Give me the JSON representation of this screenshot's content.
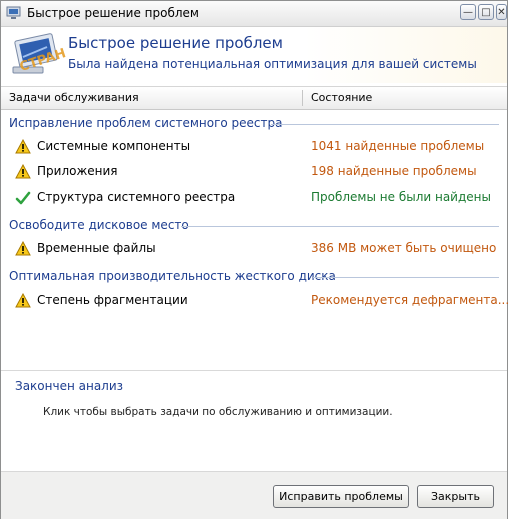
{
  "window": {
    "title": "Быстрое решение проблем"
  },
  "header": {
    "title": "Быстрое решение проблем",
    "subtitle": "Была найдена потенциальная оптимизация для вашей системы"
  },
  "columns": {
    "tasks": "Задачи обслуживания",
    "status": "Состояние"
  },
  "groups": [
    {
      "title": "Исправление проблем системного реестра",
      "items": [
        {
          "name": "Системные компоненты",
          "status": "1041 найденные проблемы",
          "icon": "warning-icon",
          "state": "warning"
        },
        {
          "name": "Приложения",
          "status": "198 найденные проблемы",
          "icon": "warning-icon",
          "state": "warning"
        },
        {
          "name": "Структура системного реестра",
          "status": "Проблемы не были найдены",
          "icon": "check-icon",
          "state": "ok"
        }
      ]
    },
    {
      "title": "Освободите дисковое место",
      "items": [
        {
          "name": "Временные файлы",
          "status": "386 MB может быть очищено",
          "icon": "warning-icon",
          "state": "warning"
        }
      ]
    },
    {
      "title": "Оптимальная производительность жесткого диска",
      "items": [
        {
          "name": "Степень фрагментации",
          "status": "Рекомендуется дефрагмента...",
          "icon": "warning-icon",
          "state": "warning"
        }
      ]
    }
  ],
  "summary": {
    "title": "Закончен анализ",
    "text": "Клик чтобы выбрать задачи по обслуживанию и оптимизации."
  },
  "buttons": {
    "fix": "Исправить проблемы",
    "close": "Закрыть"
  },
  "colors": {
    "accent": "#1d3d8f",
    "warning": "#c2580f",
    "ok": "#1b7a31"
  }
}
